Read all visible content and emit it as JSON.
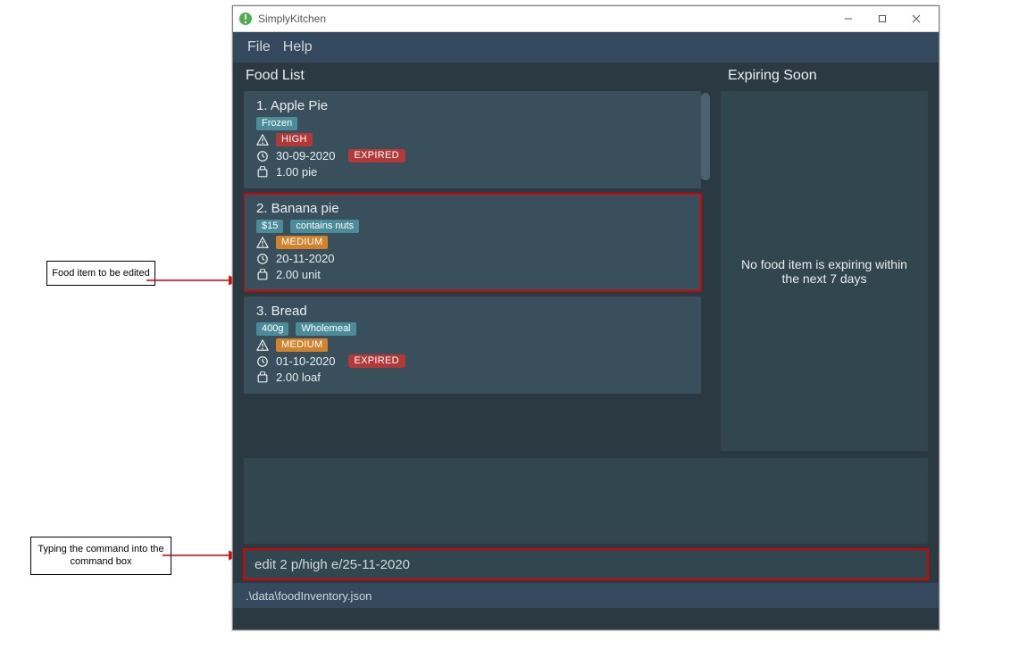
{
  "window": {
    "title": "SimplyKitchen"
  },
  "menu": {
    "file": "File",
    "help": "Help"
  },
  "sections": {
    "food_list": "Food List",
    "expiring": "Expiring Soon"
  },
  "expiring_message": "No food item is expiring within the next 7 days",
  "command_value": "edit 2 p/high e/25-11-2020",
  "status_path": ".\\data\\foodInventory.json",
  "food_items": [
    {
      "index": "1.",
      "name": "Apple Pie",
      "tags": [
        "Frozen"
      ],
      "priority": "HIGH",
      "date": "30-09-2020",
      "status": "EXPIRED",
      "qty": "1.00 pie",
      "highlight": false
    },
    {
      "index": "2.",
      "name": "Banana pie",
      "tags": [
        "$15",
        "contains nuts"
      ],
      "priority": "MEDIUM",
      "date": "20-11-2020",
      "status": "",
      "qty": "2.00 unit",
      "highlight": true
    },
    {
      "index": "3.",
      "name": "Bread",
      "tags": [
        "400g",
        "Wholemeal"
      ],
      "priority": "MEDIUM",
      "date": "01-10-2020",
      "status": "EXPIRED",
      "qty": "2.00 loaf",
      "highlight": false
    }
  ],
  "callouts": {
    "edit": "Food item to be edited",
    "cmd": "Typing the command into the command box"
  }
}
